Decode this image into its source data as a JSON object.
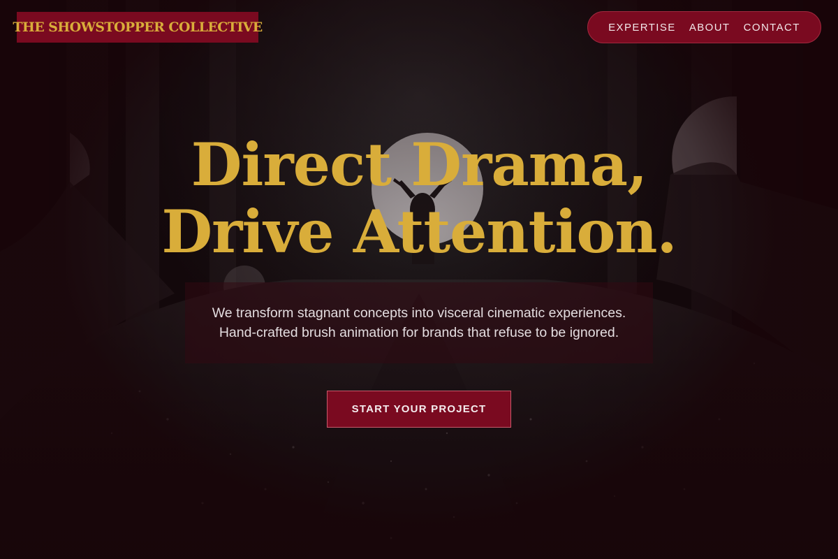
{
  "brand": {
    "name": "THE SHOWSTOPPER COLLECTIVE"
  },
  "nav": {
    "items": [
      {
        "label": "EXPERTISE"
      },
      {
        "label": "ABOUT"
      },
      {
        "label": "CONTACT"
      }
    ]
  },
  "hero": {
    "headline_line1": "Direct Drama,",
    "headline_line2": "Drive Attention.",
    "description": "We transform stagnant concepts into visceral cinematic experiences. Hand-crafted brush animation for brands that refuse to be ignored.",
    "cta_label": "START YOUR PROJECT"
  },
  "colors": {
    "accent": "#7a0a20",
    "gold": "#d9ad3a",
    "background": "#0d0608"
  }
}
